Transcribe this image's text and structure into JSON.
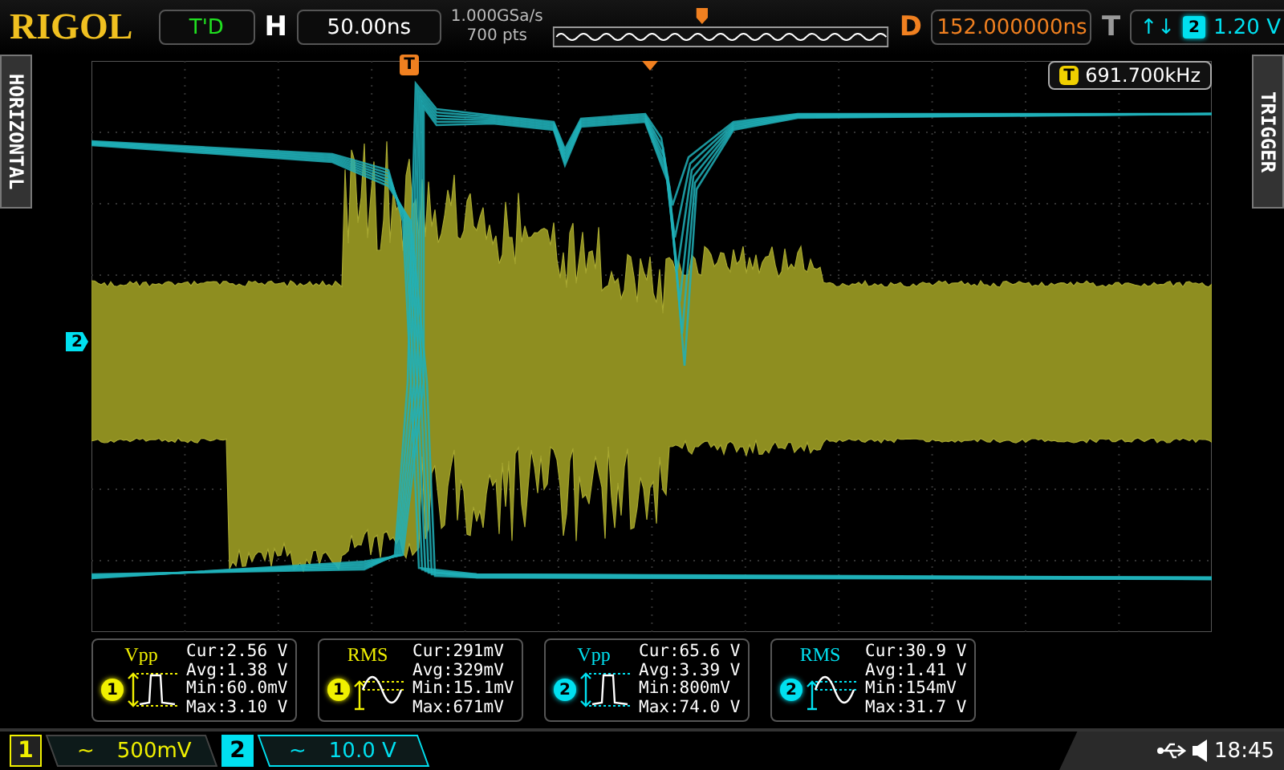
{
  "top_bar": {
    "logo": "RIGOL",
    "run_status": "T'D",
    "horizontal": {
      "label": "H",
      "value": "50.00ns"
    },
    "sample_rate": "1.000GSa/s",
    "memory_depth": "700 pts",
    "delay": {
      "label": "D",
      "value": "152.000000ns"
    },
    "trigger": {
      "label": "T",
      "slope": "↑↓",
      "channel": "2",
      "level": "1.20 V"
    }
  },
  "side_tabs": {
    "left": "HORIZONTAL",
    "right": "TRIGGER"
  },
  "screen": {
    "trigger_marker": "T",
    "channel_marker": "2",
    "frequency_counter": {
      "icon": "T",
      "value": "691.700kHz"
    }
  },
  "measurements": [
    {
      "name": "Vpp",
      "channel": "1",
      "color": "#f0f000",
      "kind": "pulse",
      "lines": [
        "Cur:2.56 V",
        "Avg:1.38 V",
        "Min:60.0mV",
        "Max:3.10 V"
      ]
    },
    {
      "name": "RMS",
      "channel": "1",
      "color": "#f0f000",
      "kind": "sine",
      "lines": [
        "Cur:291mV",
        "Avg:329mV",
        "Min:15.1mV",
        "Max:671mV"
      ]
    },
    {
      "name": "Vpp",
      "channel": "2",
      "color": "#00e0f0",
      "kind": "pulse",
      "lines": [
        "Cur:65.6 V",
        "Avg:3.39 V",
        "Min:800mV",
        "Max:74.0 V"
      ]
    },
    {
      "name": "RMS",
      "channel": "2",
      "color": "#00e0f0",
      "kind": "sine",
      "lines": [
        "Cur:30.9 V",
        "Avg:1.41 V",
        "Min:154mV",
        "Max:31.7 V"
      ]
    }
  ],
  "channels": [
    {
      "number": "1",
      "coupling": "~",
      "scale": "500mV",
      "color": "#f0f000",
      "selected": false
    },
    {
      "number": "2",
      "coupling": "~",
      "scale": "10.0 V",
      "color": "#00e0f0",
      "selected": true
    }
  ],
  "status": {
    "time": "18:45"
  }
}
